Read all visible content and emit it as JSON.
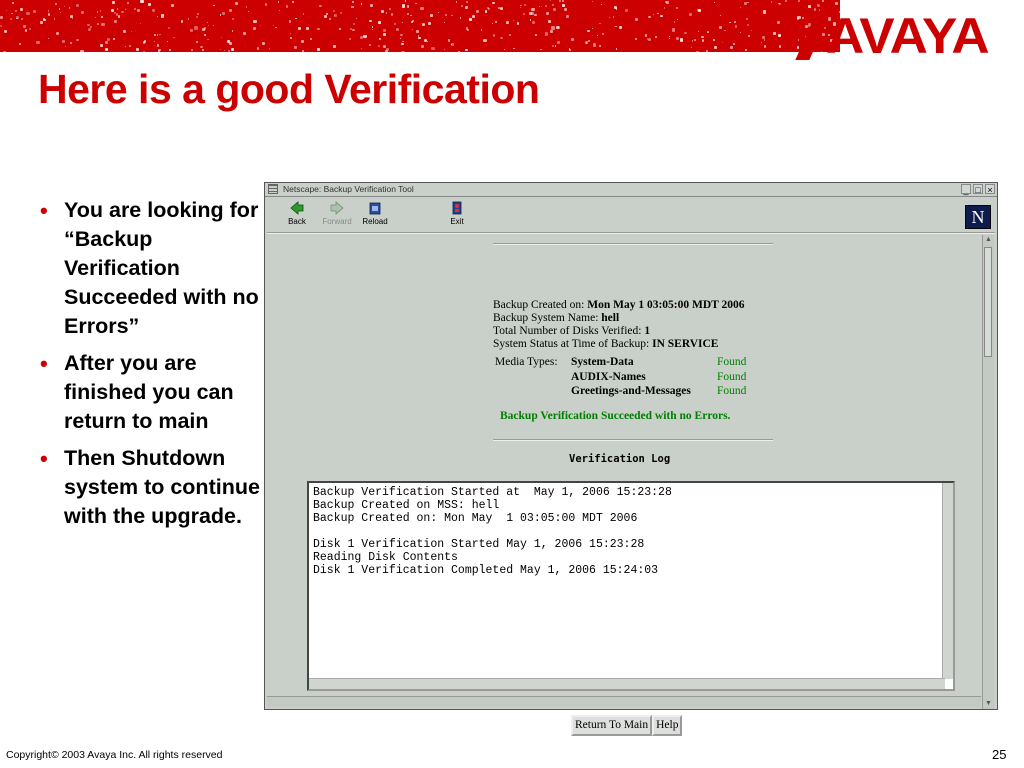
{
  "slide": {
    "title": "Here is a good Verification",
    "logo": "AVAYA",
    "bullets": [
      "You are looking for “Backup Verification Succeeded with no Errors”",
      "After you are finished you can return to main",
      "Then Shutdown system to continue with the upgrade."
    ],
    "copyright": "Copyright© 2003 Avaya Inc. All rights reserved",
    "page_number": "25",
    "brand_color": "#cc0000"
  },
  "window": {
    "title": "Netscape: Backup Verification Tool",
    "controls": [
      "_",
      "□",
      "×"
    ],
    "toolbar": [
      {
        "label": "Back",
        "icon": "back-arrow-icon",
        "enabled": true
      },
      {
        "label": "Forward",
        "icon": "forward-arrow-icon",
        "enabled": false
      },
      {
        "label": "Reload",
        "icon": "reload-icon",
        "enabled": true
      },
      {
        "label": "Exit",
        "icon": "exit-icon",
        "enabled": true
      }
    ],
    "brand_logo": "N"
  },
  "report": {
    "created_label": "Backup Created on:",
    "created_value": "Mon May 1 03:05:00 MDT 2006",
    "system_name_label": "Backup System Name:",
    "system_name_value": "hell",
    "disks_label": "Total Number of Disks Verified:",
    "disks_value": "1",
    "status_label": "System Status at Time of Backup:",
    "status_value": "IN SERVICE",
    "media_types_label": "Media Types:",
    "media_types": [
      {
        "name": "System-Data",
        "status": "Found"
      },
      {
        "name": "AUDIX-Names",
        "status": "Found"
      },
      {
        "name": "Greetings-and-Messages",
        "status": "Found"
      }
    ],
    "success_message": "Backup Verification Succeeded with no Errors.",
    "log_heading": "Verification Log",
    "log_text": "Backup Verification Started at  May 1, 2006 15:23:28\nBackup Created on MSS: hell\nBackup Created on: Mon May  1 03:05:00 MDT 2006\n\nDisk 1 Verification Started May 1, 2006 15:23:28\nReading Disk Contents\nDisk 1 Verification Completed May 1, 2006 15:24:03"
  },
  "buttons": {
    "return_main": "Return To Main",
    "help": "Help"
  }
}
